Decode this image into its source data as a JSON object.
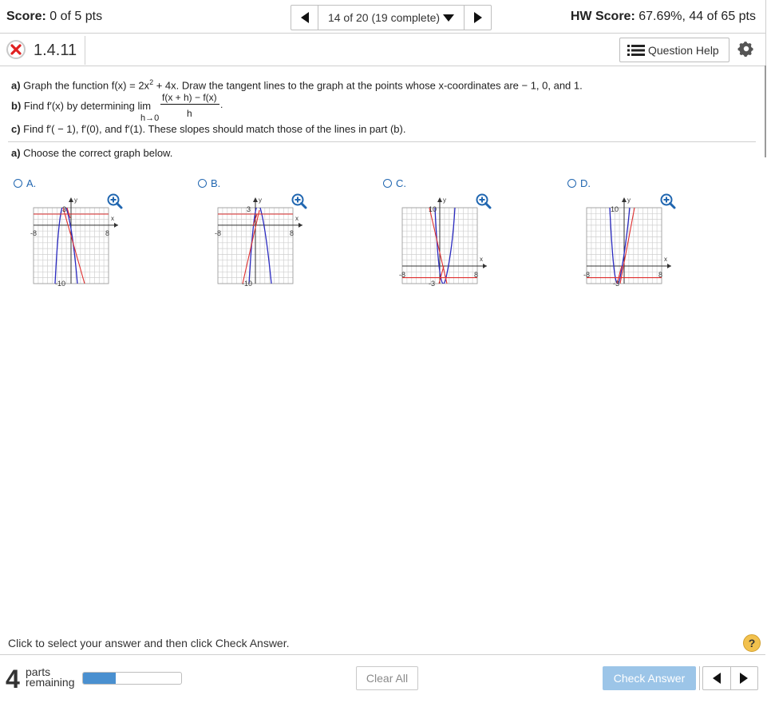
{
  "header": {
    "score_label": "Score:",
    "score_value": " 0 of 5 pts",
    "nav_position": "14 of 20 (19 complete)",
    "hw_label": "HW Score:",
    "hw_value": " 67.69%, 44 of 65 pts"
  },
  "question": {
    "id": "1.4.11",
    "help_label": "Question Help",
    "part_a_prefix": "a)",
    "part_a_text": " Graph the function f(x) = 2x",
    "part_a_exp": "2",
    "part_a_rest": " + 4x. Draw the tangent lines to the graph at the points whose x-coordinates are  − 1, 0, and 1.",
    "part_b_prefix": "b)",
    "part_b_text": " Find f′(x) by determining  lim",
    "part_b_lim_sub": "h→0",
    "part_b_numer": "f(x + h) − f(x)",
    "part_b_denom": "h",
    "part_b_end": ".",
    "part_c_prefix": "c)",
    "part_c_text": " Find f′( − 1), f′(0), and f′(1). These slopes should match those of the lines in part (b).",
    "instruction_prefix": "a)",
    "instruction_text": " Choose the correct graph below."
  },
  "options": [
    {
      "label": "A.",
      "ytop": "3",
      "ybot": "-10",
      "xmin": "-8",
      "xmax": "8"
    },
    {
      "label": "B.",
      "ytop": "3",
      "ybot": "-10",
      "xmin": "-8",
      "xmax": "8"
    },
    {
      "label": "C.",
      "ytop": "10",
      "ybot": "-3",
      "xmin": "-8",
      "xmax": "8"
    },
    {
      "label": "D.",
      "ytop": "10",
      "ybot": "-3",
      "xmin": "-8",
      "xmax": "8"
    }
  ],
  "axis": {
    "x": "x",
    "y": "y"
  },
  "footer": {
    "instruction": "Click to select your answer and then click Check Answer.",
    "help_glyph": "?",
    "parts_num": "4",
    "parts_label_1": "parts",
    "parts_label_2": "remaining",
    "progress_fraction": 0.33,
    "clear_all": "Clear All",
    "check_answer": "Check Answer"
  },
  "colors": {
    "curve": "#2a2ac0",
    "tangent": "#e03030",
    "link": "#2066b0",
    "check_btn": "#9cc5e8"
  }
}
